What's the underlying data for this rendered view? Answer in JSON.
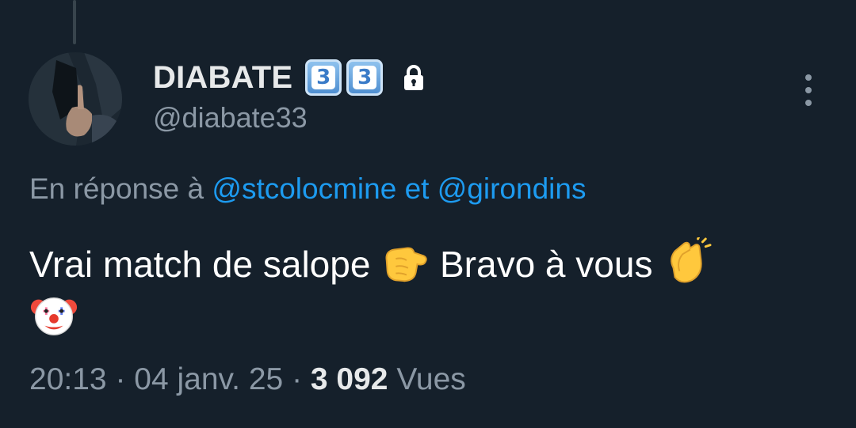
{
  "tweet": {
    "display_name": "DIABATE",
    "keycaps": [
      "3",
      "3"
    ],
    "handle": "@diabate33",
    "reply_prefix": "En réponse à",
    "reply_mentions": [
      "@stcolocmine",
      "@girondins"
    ],
    "reply_joiner": "et",
    "text_part1": "Vrai match de salope",
    "text_part2": "Bravo à vous",
    "emojis": [
      "backhand-index-pointing-icon",
      "clapping-hands-icon",
      "clown-face-icon"
    ],
    "time": "20:13",
    "date": "04 janv. 25",
    "separator": "·",
    "views_count": "3 092",
    "views_label": "Vues"
  },
  "colors": {
    "background": "#15202b",
    "primary_text": "#e7e9ea",
    "secondary_text": "#8b98a5",
    "accent": "#1d9bf0"
  }
}
